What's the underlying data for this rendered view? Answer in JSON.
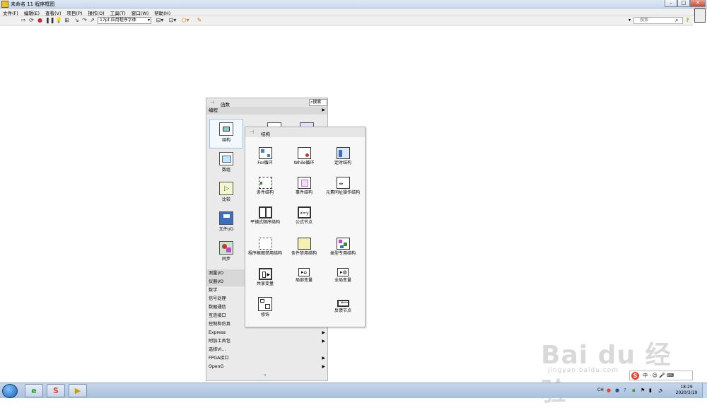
{
  "window": {
    "title": "未命名 11 程序框图"
  },
  "menubar": {
    "items": [
      "文件(F)",
      "编辑(E)",
      "查看(V)",
      "项目(P)",
      "操作(O)",
      "工具(T)",
      "窗口(W)",
      "帮助(H)"
    ]
  },
  "toolbar": {
    "font": "17pt 应用程序字体",
    "search_placeholder": "搜索"
  },
  "palette": {
    "title": "函数",
    "search_label": "搜索",
    "section": "编程",
    "categories": [
      "结构",
      "数组",
      "比较",
      "文件I/O",
      "同步"
    ],
    "list": [
      "测量I/O",
      "仪器I/O",
      "数学",
      "信号处理",
      "数据通信",
      "互连接口",
      "控制和仿真"
    ],
    "list2": [
      "Express",
      "附加工具包",
      "选择VI...",
      "FPGA接口",
      "OpenG"
    ]
  },
  "structures_palette": {
    "title": "结构",
    "items": [
      {
        "label": "For循环",
        "icon": "for-loop-icon"
      },
      {
        "label": "While循环",
        "icon": "while-loop-icon"
      },
      {
        "label": "定时结构",
        "icon": "timed-structure-icon"
      },
      {
        "label": "条件结构",
        "icon": "case-structure-icon"
      },
      {
        "label": "事件结构",
        "icon": "event-structure-icon"
      },
      {
        "label": "元素同址操作结构",
        "icon": "in-place-element-icon"
      },
      {
        "label": "平铺式顺序结构",
        "icon": "flat-sequence-icon"
      },
      {
        "label": "公式节点",
        "icon": "formula-node-icon"
      },
      {
        "label": "",
        "icon": ""
      },
      {
        "label": "程序框图禁用结构",
        "icon": "diagram-disable-icon"
      },
      {
        "label": "条件禁用结构",
        "icon": "conditional-disable-icon"
      },
      {
        "label": "类型专用结构",
        "icon": "type-specialization-icon"
      },
      {
        "label": "共享变量",
        "icon": "shared-variable-icon"
      },
      {
        "label": "局部变量",
        "icon": "local-variable-icon"
      },
      {
        "label": "全局变量",
        "icon": "global-variable-icon"
      },
      {
        "label": "修饰",
        "icon": "decorations-icon"
      },
      {
        "label": "",
        "icon": ""
      },
      {
        "label": "反馈节点",
        "icon": "feedback-node-icon"
      }
    ]
  },
  "taskbar": {
    "time": "18:29",
    "date": "2020/3/19",
    "lang": "CH"
  },
  "watermark": {
    "text": "Bai du 经验",
    "url": "jingyan.baidu.com",
    "ime": "中 · ☺ 🎤 ⌨"
  }
}
